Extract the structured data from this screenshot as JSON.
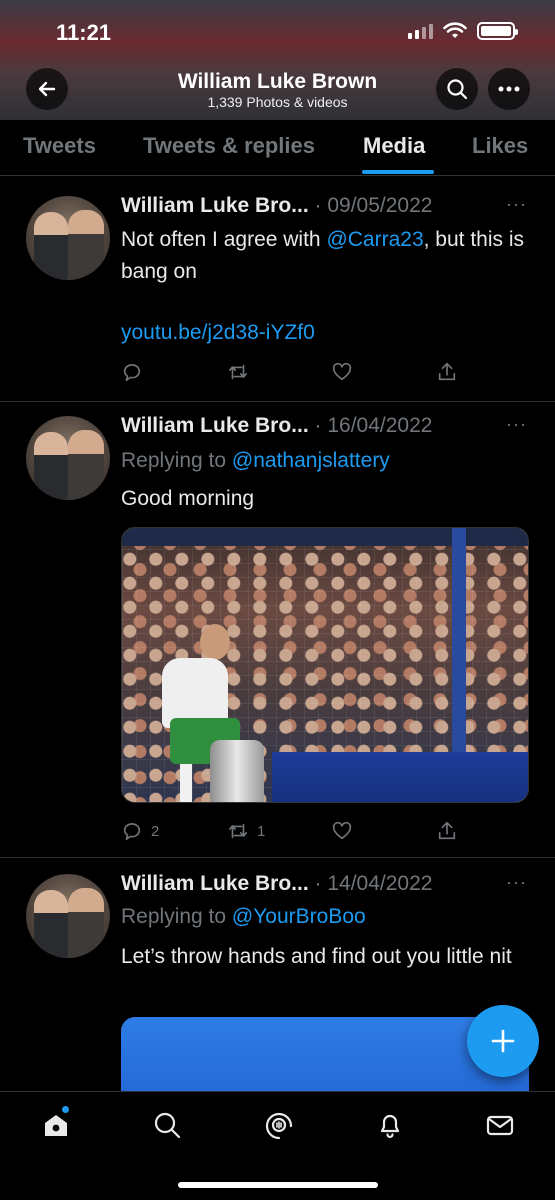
{
  "status_bar": {
    "time": "11:21"
  },
  "header": {
    "name": "William Luke Brown",
    "count": "1,339 Photos & videos"
  },
  "tabs": [
    {
      "label": "Tweets",
      "active": false
    },
    {
      "label": "Tweets & replies",
      "active": false
    },
    {
      "label": "Media",
      "active": true
    },
    {
      "label": "Likes",
      "active": false
    }
  ],
  "tweets": [
    {
      "name": "William Luke Bro...",
      "date": "· 09/05/2022",
      "text_before": "Not often I agree with ",
      "mention": "@Carra23",
      "text_after": ", but this is bang on",
      "link": "youtu.be/j2d38-iYZf0",
      "replies": "",
      "retweets": ""
    },
    {
      "name": "William Luke Bro...",
      "date": "· 16/04/2022",
      "reply_prefix": "Replying to ",
      "reply_to": "@nathanjslattery",
      "text": "Good morning",
      "replies": "2",
      "retweets": "1"
    },
    {
      "name": "William Luke Bro...",
      "date": "· 14/04/2022",
      "reply_prefix": "Replying to ",
      "reply_to": "@YourBroBoo",
      "text": "Let’s throw hands and find out you little nit"
    }
  ],
  "more_glyph": "···",
  "colors": {
    "accent": "#1d9bf0",
    "muted": "#71767b",
    "text": "#e7e9ea"
  },
  "icons": [
    "back-arrow-icon",
    "search-icon",
    "more-icon",
    "reply-icon",
    "retweet-icon",
    "like-icon",
    "share-icon",
    "compose-plus-icon",
    "home-icon",
    "explore-icon",
    "spaces-icon",
    "notifications-icon",
    "messages-icon"
  ]
}
